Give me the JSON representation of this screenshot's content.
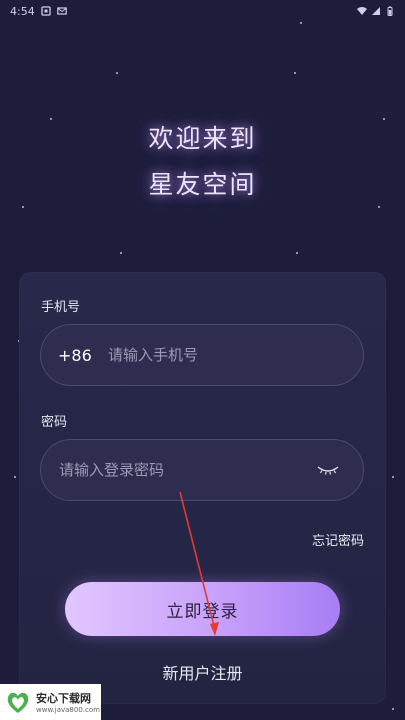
{
  "status_bar": {
    "time": "4:54"
  },
  "welcome": {
    "line1": "欢迎来到",
    "line2": "星友空间"
  },
  "phone": {
    "label": "手机号",
    "country_code": "+86",
    "placeholder": "请输入手机号",
    "value": ""
  },
  "password": {
    "label": "密码",
    "placeholder": "请输入登录密码",
    "value": "",
    "toggle_icon": "eye-closed-icon"
  },
  "forgot_label": "忘记密码",
  "login_label": "立即登录",
  "register_label": "新用户注册",
  "watermark": {
    "title": "安心下载网",
    "url": "www.java800.com"
  },
  "colors": {
    "background": "#1d1d3b",
    "card": "#252545",
    "accent_start": "#e2c6fd",
    "accent_end": "#a77df4",
    "annotation_arrow": "#e53935"
  }
}
